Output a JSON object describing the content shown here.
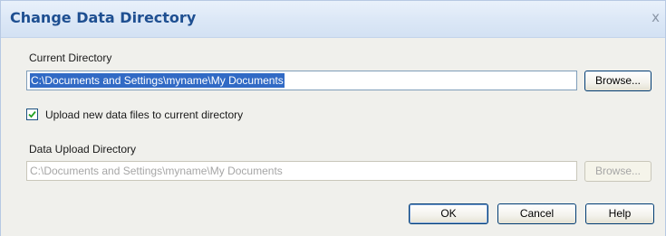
{
  "dialog": {
    "title": "Change Data Directory",
    "close_glyph": "x"
  },
  "current_directory": {
    "label": "Current Directory",
    "value": "C:\\Documents and Settings\\myname\\My Documents",
    "browse_label": "Browse..."
  },
  "upload_option": {
    "checked": true,
    "label": "Upload new data files to current directory"
  },
  "data_upload_directory": {
    "label": "Data Upload Directory",
    "value": "C:\\Documents and Settings\\myname\\My Documents",
    "browse_label": "Browse...",
    "disabled": true
  },
  "actions": {
    "ok_label": "OK",
    "cancel_label": "Cancel",
    "help_label": "Help"
  },
  "colors": {
    "title_text": "#1e4f91",
    "selection": "#316ac5"
  }
}
